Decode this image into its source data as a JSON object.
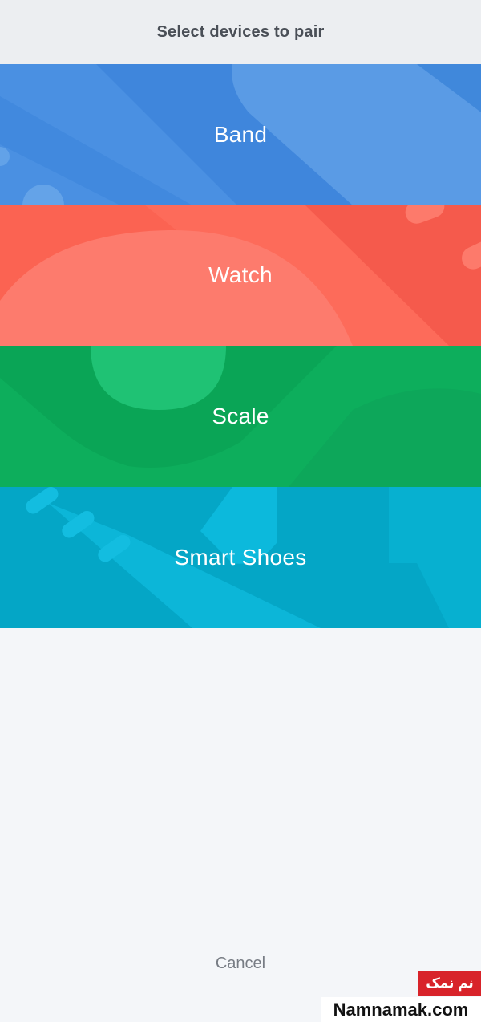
{
  "header": {
    "title": "Select devices to pair"
  },
  "devices": [
    {
      "label": "Band",
      "color": "#4a90e2"
    },
    {
      "label": "Watch",
      "color": "#fb6352"
    },
    {
      "label": "Scale",
      "color": "#0dae5c"
    },
    {
      "label": "Smart Shoes",
      "color": "#05aacb"
    }
  ],
  "footer": {
    "cancel_label": "Cancel"
  },
  "watermark": {
    "logo_text": "نم نمک",
    "site": "Namnamak.com"
  }
}
